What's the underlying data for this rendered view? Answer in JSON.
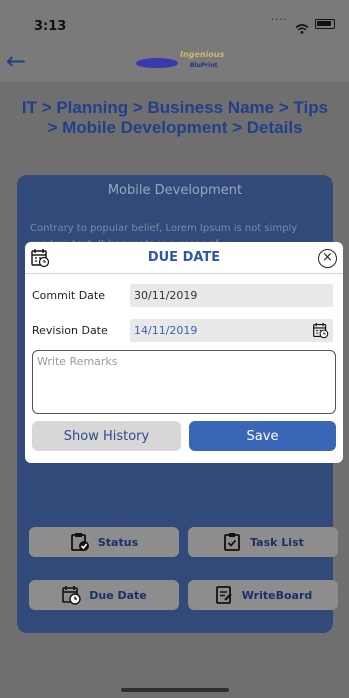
{
  "status_bar": {
    "time": "3:13"
  },
  "nav": {
    "back_glyph": "←",
    "logo_name": "Ingenious",
    "logo_sub": "BluPrint"
  },
  "breadcrumb": "IT > Planning > Business Name > Tips > Mobile Development > Details",
  "panel": {
    "title": "Mobile Development",
    "body": "Contrary to popular belief, Lorem Ipsum is not simply random text. It has roots in a piece of"
  },
  "modal": {
    "title": "DUE DATE",
    "close_glyph": "×",
    "commit_label": "Commit Date",
    "commit_value": "30/11/2019",
    "revision_label": "Revision Date",
    "revision_value": "14/11/2019",
    "remarks_placeholder": "Write Remarks",
    "history_label": "Show History",
    "save_label": "Save"
  },
  "actions": {
    "status": "Status",
    "task_list": "Task List",
    "due_date": "Due Date",
    "writeboard": "WriteBoard"
  },
  "colors": {
    "accent": "#3a66b7",
    "title_blue": "#2f57a8",
    "panel": "#314a7a",
    "overlay": "#6f6f6f"
  },
  "icons": {
    "calendar": "calendar-icon",
    "close": "close-icon",
    "status": "status-icon",
    "tasklist": "task-list-icon",
    "writeboard": "writeboard-icon"
  }
}
